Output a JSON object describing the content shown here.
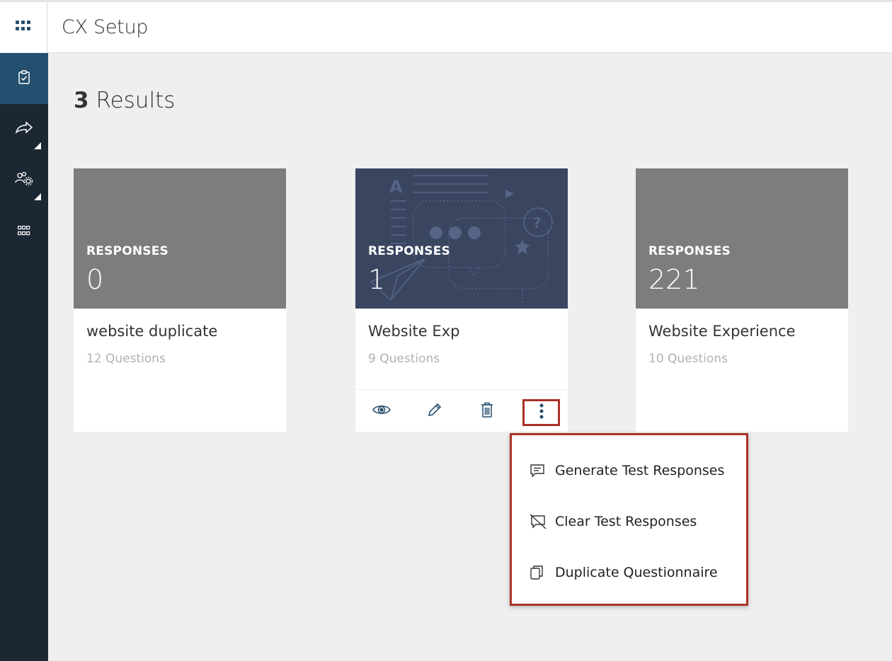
{
  "header": {
    "title": "CX Setup",
    "apps_icon": "grid-icon"
  },
  "sidebar": {
    "items": [
      {
        "icon": "clipboard-check-icon",
        "active": true
      },
      {
        "icon": "share-arrow-icon",
        "submenu": true
      },
      {
        "icon": "users-gear-icon",
        "submenu": true
      },
      {
        "icon": "apps-grid-icon"
      }
    ]
  },
  "results": {
    "count": "3",
    "label": "Results"
  },
  "cards": [
    {
      "responses_label": "RESPONSES",
      "responses": "0",
      "title": "website duplicate",
      "questions": "12 Questions"
    },
    {
      "responses_label": "RESPONSES",
      "responses": "1",
      "title": "Website Exp",
      "questions": "9 Questions"
    },
    {
      "responses_label": "RESPONSES",
      "responses": "221",
      "title": "Website Experience",
      "questions": "10 Questions"
    }
  ],
  "card_actions": [
    "eye-icon",
    "pencil-icon",
    "trash-icon",
    "more-vertical-icon"
  ],
  "menu": {
    "items": [
      {
        "label": "Generate Test Responses",
        "icon": "message-icon"
      },
      {
        "label": "Clear Test Responses",
        "icon": "message-off-icon"
      },
      {
        "label": "Duplicate Questionnaire",
        "icon": "copy-icon"
      }
    ]
  },
  "colors": {
    "sidebar": "#1c2734",
    "sidebar_active": "#244f6e",
    "card_gray": "#7d7d7d",
    "card_dark": "#3a4660",
    "highlight": "#a93226",
    "icon_blue": "#244f6e"
  }
}
